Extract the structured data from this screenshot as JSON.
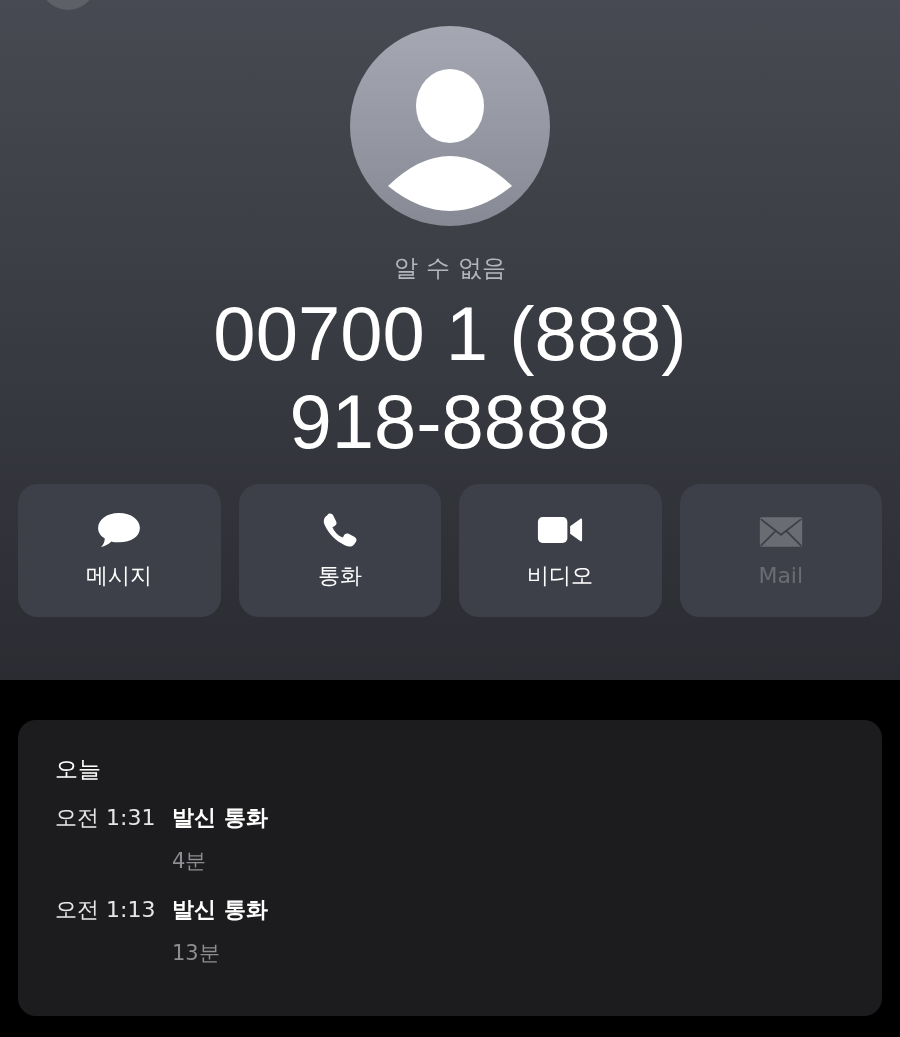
{
  "contact": {
    "name": "알 수 없음",
    "number_lines": [
      "00700 1 (888)",
      "918-8888"
    ]
  },
  "actions": [
    {
      "kind": "message",
      "label": "메시지",
      "disabled": false
    },
    {
      "kind": "phone",
      "label": "통화",
      "disabled": false
    },
    {
      "kind": "video",
      "label": "비디오",
      "disabled": false
    },
    {
      "kind": "mail",
      "label": "Mail",
      "disabled": true
    }
  ],
  "recents": {
    "heading": "오늘",
    "calls": [
      {
        "time": "오전 1:31",
        "type": "발신 통화",
        "duration": "4분"
      },
      {
        "time": "오전 1:13",
        "type": "발신 통화",
        "duration": "13분"
      }
    ]
  }
}
